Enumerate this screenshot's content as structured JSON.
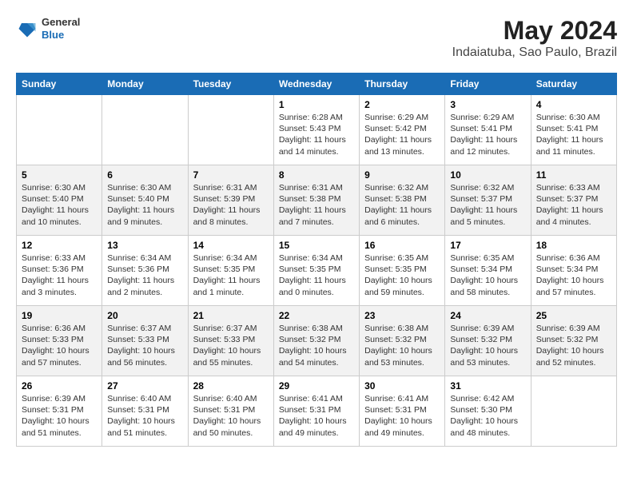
{
  "logo": {
    "line1": "General",
    "line2": "Blue"
  },
  "title": "May 2024",
  "subtitle": "Indaiatuba, Sao Paulo, Brazil",
  "weekdays": [
    "Sunday",
    "Monday",
    "Tuesday",
    "Wednesday",
    "Thursday",
    "Friday",
    "Saturday"
  ],
  "weeks": [
    [
      {
        "day": "",
        "info": ""
      },
      {
        "day": "",
        "info": ""
      },
      {
        "day": "",
        "info": ""
      },
      {
        "day": "1",
        "info": "Sunrise: 6:28 AM\nSunset: 5:43 PM\nDaylight: 11 hours and 14 minutes."
      },
      {
        "day": "2",
        "info": "Sunrise: 6:29 AM\nSunset: 5:42 PM\nDaylight: 11 hours and 13 minutes."
      },
      {
        "day": "3",
        "info": "Sunrise: 6:29 AM\nSunset: 5:41 PM\nDaylight: 11 hours and 12 minutes."
      },
      {
        "day": "4",
        "info": "Sunrise: 6:30 AM\nSunset: 5:41 PM\nDaylight: 11 hours and 11 minutes."
      }
    ],
    [
      {
        "day": "5",
        "info": "Sunrise: 6:30 AM\nSunset: 5:40 PM\nDaylight: 11 hours and 10 minutes."
      },
      {
        "day": "6",
        "info": "Sunrise: 6:30 AM\nSunset: 5:40 PM\nDaylight: 11 hours and 9 minutes."
      },
      {
        "day": "7",
        "info": "Sunrise: 6:31 AM\nSunset: 5:39 PM\nDaylight: 11 hours and 8 minutes."
      },
      {
        "day": "8",
        "info": "Sunrise: 6:31 AM\nSunset: 5:38 PM\nDaylight: 11 hours and 7 minutes."
      },
      {
        "day": "9",
        "info": "Sunrise: 6:32 AM\nSunset: 5:38 PM\nDaylight: 11 hours and 6 minutes."
      },
      {
        "day": "10",
        "info": "Sunrise: 6:32 AM\nSunset: 5:37 PM\nDaylight: 11 hours and 5 minutes."
      },
      {
        "day": "11",
        "info": "Sunrise: 6:33 AM\nSunset: 5:37 PM\nDaylight: 11 hours and 4 minutes."
      }
    ],
    [
      {
        "day": "12",
        "info": "Sunrise: 6:33 AM\nSunset: 5:36 PM\nDaylight: 11 hours and 3 minutes."
      },
      {
        "day": "13",
        "info": "Sunrise: 6:34 AM\nSunset: 5:36 PM\nDaylight: 11 hours and 2 minutes."
      },
      {
        "day": "14",
        "info": "Sunrise: 6:34 AM\nSunset: 5:35 PM\nDaylight: 11 hours and 1 minute."
      },
      {
        "day": "15",
        "info": "Sunrise: 6:34 AM\nSunset: 5:35 PM\nDaylight: 11 hours and 0 minutes."
      },
      {
        "day": "16",
        "info": "Sunrise: 6:35 AM\nSunset: 5:35 PM\nDaylight: 10 hours and 59 minutes."
      },
      {
        "day": "17",
        "info": "Sunrise: 6:35 AM\nSunset: 5:34 PM\nDaylight: 10 hours and 58 minutes."
      },
      {
        "day": "18",
        "info": "Sunrise: 6:36 AM\nSunset: 5:34 PM\nDaylight: 10 hours and 57 minutes."
      }
    ],
    [
      {
        "day": "19",
        "info": "Sunrise: 6:36 AM\nSunset: 5:33 PM\nDaylight: 10 hours and 57 minutes."
      },
      {
        "day": "20",
        "info": "Sunrise: 6:37 AM\nSunset: 5:33 PM\nDaylight: 10 hours and 56 minutes."
      },
      {
        "day": "21",
        "info": "Sunrise: 6:37 AM\nSunset: 5:33 PM\nDaylight: 10 hours and 55 minutes."
      },
      {
        "day": "22",
        "info": "Sunrise: 6:38 AM\nSunset: 5:32 PM\nDaylight: 10 hours and 54 minutes."
      },
      {
        "day": "23",
        "info": "Sunrise: 6:38 AM\nSunset: 5:32 PM\nDaylight: 10 hours and 53 minutes."
      },
      {
        "day": "24",
        "info": "Sunrise: 6:39 AM\nSunset: 5:32 PM\nDaylight: 10 hours and 53 minutes."
      },
      {
        "day": "25",
        "info": "Sunrise: 6:39 AM\nSunset: 5:32 PM\nDaylight: 10 hours and 52 minutes."
      }
    ],
    [
      {
        "day": "26",
        "info": "Sunrise: 6:39 AM\nSunset: 5:31 PM\nDaylight: 10 hours and 51 minutes."
      },
      {
        "day": "27",
        "info": "Sunrise: 6:40 AM\nSunset: 5:31 PM\nDaylight: 10 hours and 51 minutes."
      },
      {
        "day": "28",
        "info": "Sunrise: 6:40 AM\nSunset: 5:31 PM\nDaylight: 10 hours and 50 minutes."
      },
      {
        "day": "29",
        "info": "Sunrise: 6:41 AM\nSunset: 5:31 PM\nDaylight: 10 hours and 49 minutes."
      },
      {
        "day": "30",
        "info": "Sunrise: 6:41 AM\nSunset: 5:31 PM\nDaylight: 10 hours and 49 minutes."
      },
      {
        "day": "31",
        "info": "Sunrise: 6:42 AM\nSunset: 5:30 PM\nDaylight: 10 hours and 48 minutes."
      },
      {
        "day": "",
        "info": ""
      }
    ]
  ]
}
